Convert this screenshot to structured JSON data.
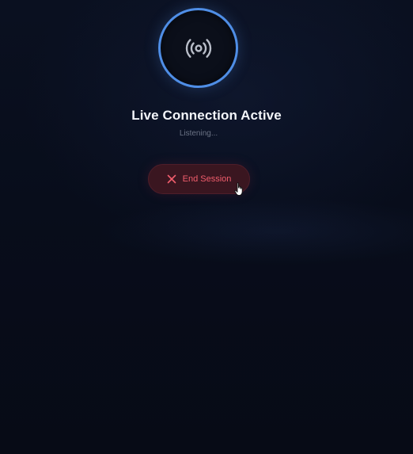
{
  "connection": {
    "title": "Live Connection Active",
    "status": "Listening..."
  },
  "actions": {
    "end_session_label": "End Session"
  },
  "icons": {
    "avatar": "broadcast-icon",
    "end_session": "close-icon",
    "pointer": "hand-pointer-icon"
  },
  "colors": {
    "ring_accent": "#4f8ee6",
    "danger_text": "#f05d6c",
    "danger_bg": "#3a1620",
    "title_text": "#f3f5fa",
    "status_text": "#6b7385"
  }
}
